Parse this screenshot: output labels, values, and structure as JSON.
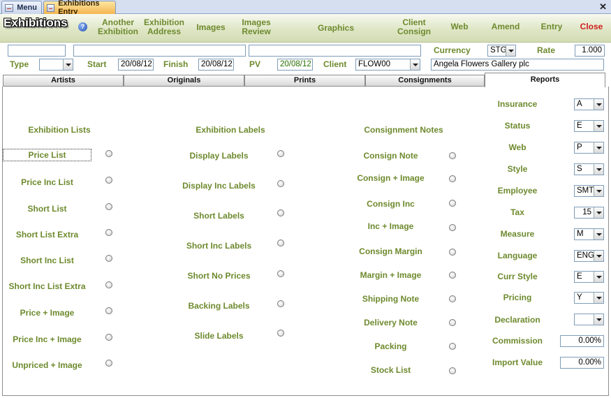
{
  "tabs": {
    "menu": "Menu",
    "entry": "Exhibitions Entry"
  },
  "header": {
    "title": "Exhibitions",
    "buttons": [
      {
        "id": "another",
        "l1": "Another",
        "l2": "Exhibition"
      },
      {
        "id": "address",
        "l1": "Exhibition",
        "l2": "Address"
      },
      {
        "id": "images",
        "l1": "Images",
        "l2": ""
      },
      {
        "id": "images-review",
        "l1": "Images",
        "l2": "Review"
      },
      {
        "id": "graphics",
        "l1": "Graphics",
        "l2": ""
      },
      {
        "id": "client-consign",
        "l1": "Client",
        "l2": "Consign"
      },
      {
        "id": "web",
        "l1": "Web",
        "l2": ""
      },
      {
        "id": "amend",
        "l1": "Amend",
        "l2": ""
      },
      {
        "id": "entry",
        "l1": "Entry",
        "l2": ""
      },
      {
        "id": "close",
        "l1": "Close",
        "l2": ""
      }
    ]
  },
  "form": {
    "labels": {
      "currency": "Currency",
      "rate": "Rate",
      "type": "Type",
      "start": "Start",
      "finish": "Finish",
      "pv": "PV",
      "client": "Client"
    },
    "currency": "STG",
    "rate": "1.000",
    "type": "",
    "start": "20/08/12",
    "finish": "20/08/12",
    "pv": "20/08/12",
    "client_code": "FLOW00",
    "client_name": "Angela Flowers Gallery plc",
    "field1": "",
    "field2": "",
    "field3": ""
  },
  "page_tabs": [
    "Artists",
    "Originals",
    "Prints",
    "Consignments",
    "Reports"
  ],
  "reports": {
    "col1_title": "Exhibition Lists",
    "col1": [
      "Price List",
      "Price Inc List",
      "Short List",
      "Short List Extra",
      "Short Inc List",
      "Short Inc List Extra",
      "Price + Image",
      "Price Inc + Image",
      "Unpriced + Image"
    ],
    "col2_title": "Exhibition Labels",
    "col2": [
      "Display Labels",
      "Display Inc Labels",
      "Short Labels",
      "Short Inc Labels",
      "Short No Prices",
      "Backing Labels",
      "Slide Labels"
    ],
    "col3_title": "Consignment Notes",
    "col3": [
      "Consign Note",
      "Consign + Image",
      "Consign Inc",
      "Inc + Image",
      "Consign Margin",
      "Margin + Image",
      "Shipping Note",
      "Delivery Note",
      "Packing",
      "Stock List"
    ]
  },
  "options": [
    {
      "label": "Insurance",
      "value": "A"
    },
    {
      "label": "Status",
      "value": "E"
    },
    {
      "label": "Web",
      "value": "P"
    },
    {
      "label": "Style",
      "value": "S"
    },
    {
      "label": "Employee",
      "value": "SMT"
    },
    {
      "label": "Tax",
      "value": "15"
    },
    {
      "label": "Measure",
      "value": "M"
    },
    {
      "label": "Language",
      "value": "ENG"
    },
    {
      "label": "Curr Style",
      "value": "E"
    },
    {
      "label": "Pricing",
      "value": "Y"
    },
    {
      "label": "Declaration",
      "value": ""
    }
  ],
  "commission": {
    "label": "Commission",
    "value": "0.00%"
  },
  "import_value": {
    "label": "Import Value",
    "value": "0.00%"
  }
}
